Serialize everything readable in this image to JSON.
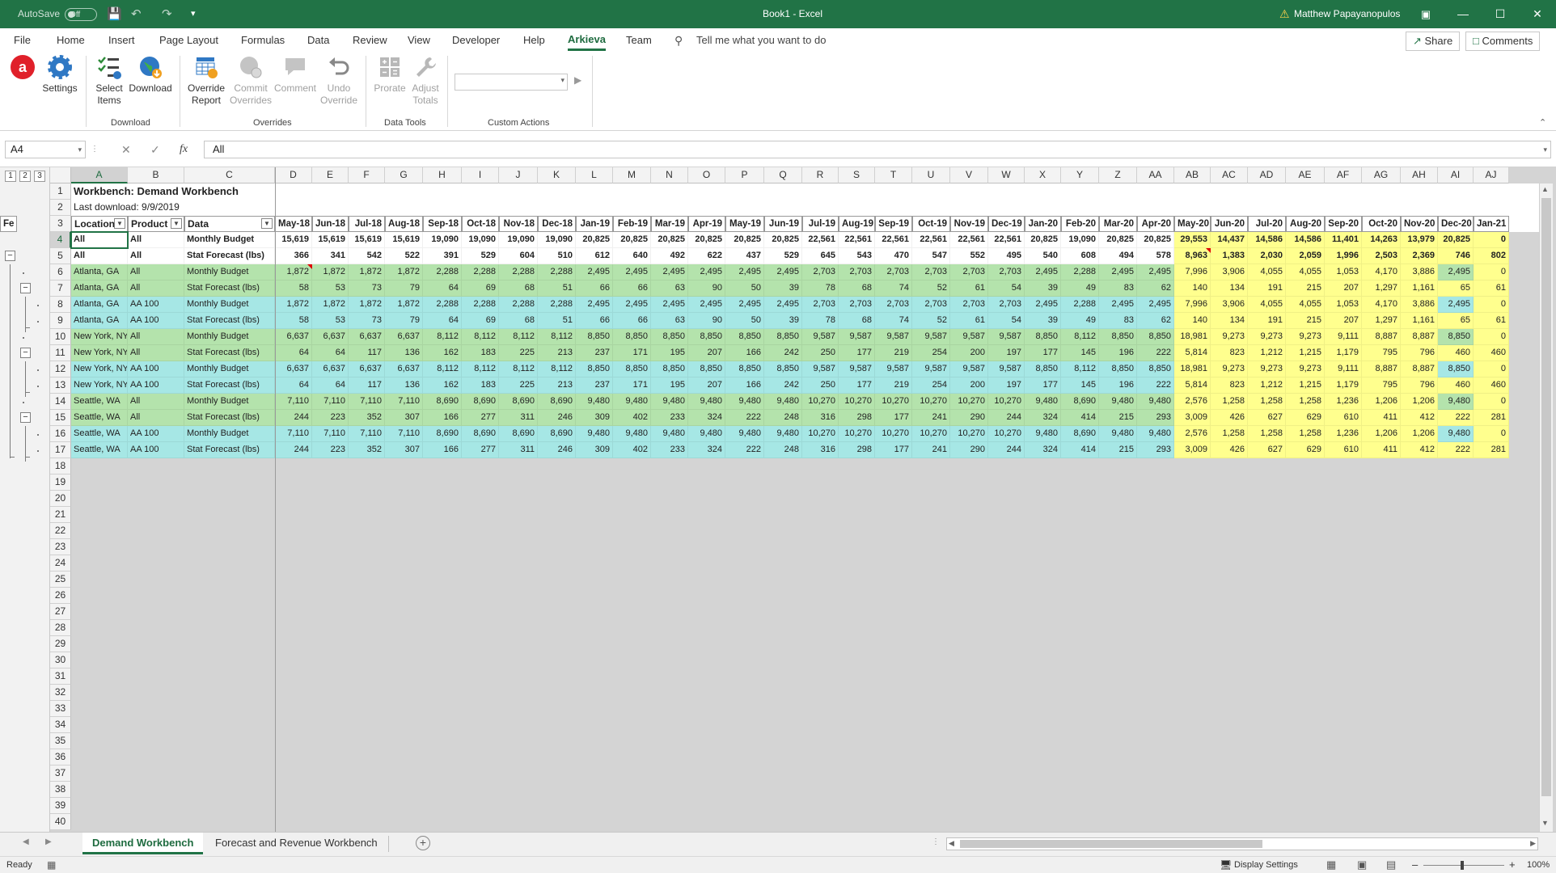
{
  "titlebar": {
    "autosave_label": "AutoSave",
    "autosave_state": "Off",
    "title": "Book1 - Excel",
    "user": "Matthew Papayanopulos"
  },
  "tabs": [
    "File",
    "Home",
    "Insert",
    "Page Layout",
    "Formulas",
    "Data",
    "Review",
    "View",
    "Developer",
    "Help",
    "Arkieva",
    "Team"
  ],
  "active_tab": "Arkieva",
  "tell_me": "Tell me what you want to do",
  "share_label": "Share",
  "comments_label": "Comments",
  "ribbon": {
    "settings": "Settings",
    "select_items": [
      "Select",
      "Items"
    ],
    "download": "Download",
    "override_report": [
      "Override",
      "Report"
    ],
    "commit_overrides": [
      "Commit",
      "Overrides"
    ],
    "comment": "Comment",
    "undo_override": [
      "Undo",
      "Override"
    ],
    "prorate": "Prorate",
    "adjust_totals": [
      "Adjust",
      "Totals"
    ],
    "groups": {
      "download": "Download",
      "overrides": "Overrides",
      "data_tools": "Data Tools",
      "custom_actions": "Custom Actions"
    }
  },
  "formula_bar": {
    "name_box": "A4",
    "value": "All"
  },
  "outline_levels": [
    "1",
    "2",
    "3"
  ],
  "sheet": {
    "title": "Workbench: Demand Workbench",
    "last_download": "Last download: 9/9/2019",
    "selected_cell": "A4",
    "columns": [
      "A",
      "B",
      "C",
      "D",
      "E",
      "F",
      "G",
      "H",
      "I",
      "J",
      "K",
      "L",
      "M",
      "N",
      "O",
      "P",
      "Q",
      "R",
      "S",
      "T",
      "U",
      "V",
      "W",
      "X",
      "Y",
      "Z",
      "AA",
      "AB",
      "AC",
      "AD",
      "AE",
      "AF",
      "AG",
      "AH",
      "AI",
      "AJ"
    ],
    "header_labels": [
      "Location",
      "Product",
      "Data"
    ],
    "months": [
      "May-18",
      "Jun-18",
      "Jul-18",
      "Aug-18",
      "Sep-18",
      "Oct-18",
      "Nov-18",
      "Dec-18",
      "Jan-19",
      "Feb-19",
      "Mar-19",
      "Apr-19",
      "May-19",
      "Jun-19",
      "Jul-19",
      "Aug-19",
      "Sep-19",
      "Oct-19",
      "Nov-19",
      "Dec-19",
      "Jan-20",
      "Feb-20",
      "Mar-20",
      "Apr-20",
      "May-20",
      "Jun-20",
      "Jul-20",
      "Aug-20",
      "Sep-20",
      "Oct-20",
      "Nov-20",
      "Dec-20",
      "Jan-21",
      "Fe"
    ],
    "row_numbers": [
      "1",
      "2",
      "3",
      "4",
      "5",
      "6",
      "7",
      "8",
      "9",
      "10",
      "11",
      "12",
      "13",
      "14",
      "15",
      "16",
      "17",
      "18",
      "19",
      "20",
      "21",
      "22",
      "23",
      "24",
      "25",
      "26",
      "27",
      "28",
      "29",
      "30",
      "31",
      "32",
      "33",
      "34",
      "35",
      "36",
      "37",
      "38",
      "39",
      "40"
    ],
    "rows": [
      {
        "loc": "All",
        "prod": "All",
        "data": "Monthly Budget",
        "values": [
          "15,619",
          "15,619",
          "15,619",
          "15,619",
          "19,090",
          "19,090",
          "19,090",
          "19,090",
          "20,825",
          "20,825",
          "20,825",
          "20,825",
          "20,825",
          "20,825",
          "22,561",
          "22,561",
          "22,561",
          "22,561",
          "22,561",
          "22,561",
          "20,825",
          "19,090",
          "20,825",
          "20,825",
          "29,553",
          "14,437",
          "14,586",
          "14,586",
          "11,401",
          "14,263",
          "13,979",
          "20,825",
          "0"
        ]
      },
      {
        "loc": "All",
        "prod": "All",
        "data": "Stat Forecast (lbs)",
        "values": [
          "366",
          "341",
          "542",
          "522",
          "391",
          "529",
          "604",
          "510",
          "612",
          "640",
          "492",
          "622",
          "437",
          "529",
          "645",
          "543",
          "470",
          "547",
          "552",
          "495",
          "540",
          "608",
          "494",
          "578",
          "8,963",
          "1,383",
          "2,030",
          "2,059",
          "1,996",
          "2,503",
          "2,369",
          "746",
          "802"
        ]
      },
      {
        "loc": "Atlanta, GA",
        "prod": "All",
        "data": "Monthly Budget",
        "values": [
          "1,872",
          "1,872",
          "1,872",
          "1,872",
          "2,288",
          "2,288",
          "2,288",
          "2,288",
          "2,495",
          "2,495",
          "2,495",
          "2,495",
          "2,495",
          "2,495",
          "2,703",
          "2,703",
          "2,703",
          "2,703",
          "2,703",
          "2,703",
          "2,495",
          "2,288",
          "2,495",
          "2,495",
          "7,996",
          "3,906",
          "4,055",
          "4,055",
          "1,053",
          "4,170",
          "3,886",
          "2,495",
          "0"
        ]
      },
      {
        "loc": "Atlanta, GA",
        "prod": "All",
        "data": "Stat Forecast (lbs)",
        "values": [
          "58",
          "53",
          "73",
          "79",
          "64",
          "69",
          "68",
          "51",
          "66",
          "66",
          "63",
          "90",
          "50",
          "39",
          "78",
          "68",
          "74",
          "52",
          "61",
          "54",
          "39",
          "49",
          "83",
          "62",
          "140",
          "134",
          "191",
          "215",
          "207",
          "1,297",
          "1,161",
          "65",
          "61"
        ]
      },
      {
        "loc": "Atlanta, GA",
        "prod": "AA 100",
        "data": "Monthly Budget",
        "values": [
          "1,872",
          "1,872",
          "1,872",
          "1,872",
          "2,288",
          "2,288",
          "2,288",
          "2,288",
          "2,495",
          "2,495",
          "2,495",
          "2,495",
          "2,495",
          "2,495",
          "2,703",
          "2,703",
          "2,703",
          "2,703",
          "2,703",
          "2,703",
          "2,495",
          "2,288",
          "2,495",
          "2,495",
          "7,996",
          "3,906",
          "4,055",
          "4,055",
          "1,053",
          "4,170",
          "3,886",
          "2,495",
          "0"
        ]
      },
      {
        "loc": "Atlanta, GA",
        "prod": "AA 100",
        "data": "Stat Forecast (lbs)",
        "values": [
          "58",
          "53",
          "73",
          "79",
          "64",
          "69",
          "68",
          "51",
          "66",
          "66",
          "63",
          "90",
          "50",
          "39",
          "78",
          "68",
          "74",
          "52",
          "61",
          "54",
          "39",
          "49",
          "83",
          "62",
          "140",
          "134",
          "191",
          "215",
          "207",
          "1,297",
          "1,161",
          "65",
          "61"
        ]
      },
      {
        "loc": "New York, NY",
        "prod": "All",
        "data": "Monthly Budget",
        "values": [
          "6,637",
          "6,637",
          "6,637",
          "6,637",
          "8,112",
          "8,112",
          "8,112",
          "8,112",
          "8,850",
          "8,850",
          "8,850",
          "8,850",
          "8,850",
          "8,850",
          "9,587",
          "9,587",
          "9,587",
          "9,587",
          "9,587",
          "9,587",
          "8,850",
          "8,112",
          "8,850",
          "8,850",
          "18,981",
          "9,273",
          "9,273",
          "9,273",
          "9,111",
          "8,887",
          "8,887",
          "8,850",
          "0"
        ]
      },
      {
        "loc": "New York, NY",
        "prod": "All",
        "data": "Stat Forecast (lbs)",
        "values": [
          "64",
          "64",
          "117",
          "136",
          "162",
          "183",
          "225",
          "213",
          "237",
          "171",
          "195",
          "207",
          "166",
          "242",
          "250",
          "177",
          "219",
          "254",
          "200",
          "197",
          "177",
          "145",
          "196",
          "222",
          "5,814",
          "823",
          "1,212",
          "1,215",
          "1,179",
          "795",
          "796",
          "460",
          "460"
        ]
      },
      {
        "loc": "New York, NY",
        "prod": "AA 100",
        "data": "Monthly Budget",
        "values": [
          "6,637",
          "6,637",
          "6,637",
          "6,637",
          "8,112",
          "8,112",
          "8,112",
          "8,112",
          "8,850",
          "8,850",
          "8,850",
          "8,850",
          "8,850",
          "8,850",
          "9,587",
          "9,587",
          "9,587",
          "9,587",
          "9,587",
          "9,587",
          "8,850",
          "8,112",
          "8,850",
          "8,850",
          "18,981",
          "9,273",
          "9,273",
          "9,273",
          "9,111",
          "8,887",
          "8,887",
          "8,850",
          "0"
        ]
      },
      {
        "loc": "New York, NY",
        "prod": "AA 100",
        "data": "Stat Forecast (lbs)",
        "values": [
          "64",
          "64",
          "117",
          "136",
          "162",
          "183",
          "225",
          "213",
          "237",
          "171",
          "195",
          "207",
          "166",
          "242",
          "250",
          "177",
          "219",
          "254",
          "200",
          "197",
          "177",
          "145",
          "196",
          "222",
          "5,814",
          "823",
          "1,212",
          "1,215",
          "1,179",
          "795",
          "796",
          "460",
          "460"
        ]
      },
      {
        "loc": "Seattle, WA",
        "prod": "All",
        "data": "Monthly Budget",
        "values": [
          "7,110",
          "7,110",
          "7,110",
          "7,110",
          "8,690",
          "8,690",
          "8,690",
          "8,690",
          "9,480",
          "9,480",
          "9,480",
          "9,480",
          "9,480",
          "9,480",
          "10,270",
          "10,270",
          "10,270",
          "10,270",
          "10,270",
          "10,270",
          "9,480",
          "8,690",
          "9,480",
          "9,480",
          "2,576",
          "1,258",
          "1,258",
          "1,258",
          "1,236",
          "1,206",
          "1,206",
          "9,480",
          "0"
        ]
      },
      {
        "loc": "Seattle, WA",
        "prod": "All",
        "data": "Stat Forecast (lbs)",
        "values": [
          "244",
          "223",
          "352",
          "307",
          "166",
          "277",
          "311",
          "246",
          "309",
          "402",
          "233",
          "324",
          "222",
          "248",
          "316",
          "298",
          "177",
          "241",
          "290",
          "244",
          "324",
          "414",
          "215",
          "293",
          "3,009",
          "426",
          "627",
          "629",
          "610",
          "411",
          "412",
          "222",
          "281"
        ]
      },
      {
        "loc": "Seattle, WA",
        "prod": "AA 100",
        "data": "Monthly Budget",
        "values": [
          "7,110",
          "7,110",
          "7,110",
          "7,110",
          "8,690",
          "8,690",
          "8,690",
          "8,690",
          "9,480",
          "9,480",
          "9,480",
          "9,480",
          "9,480",
          "9,480",
          "10,270",
          "10,270",
          "10,270",
          "10,270",
          "10,270",
          "10,270",
          "9,480",
          "8,690",
          "9,480",
          "9,480",
          "2,576",
          "1,258",
          "1,258",
          "1,258",
          "1,236",
          "1,206",
          "1,206",
          "9,480",
          "0"
        ]
      },
      {
        "loc": "Seattle, WA",
        "prod": "AA 100",
        "data": "Stat Forecast (lbs)",
        "values": [
          "244",
          "223",
          "352",
          "307",
          "166",
          "277",
          "311",
          "246",
          "309",
          "402",
          "233",
          "324",
          "222",
          "248",
          "316",
          "298",
          "177",
          "241",
          "290",
          "244",
          "324",
          "414",
          "215",
          "293",
          "3,009",
          "426",
          "627",
          "629",
          "610",
          "411",
          "412",
          "222",
          "281"
        ]
      }
    ]
  },
  "sheet_tabs": [
    "Demand Workbench",
    "Forecast and Revenue Workbench"
  ],
  "active_sheet": "Demand Workbench",
  "status": {
    "ready": "Ready",
    "display_settings": "Display Settings",
    "zoom": "100%"
  },
  "colors": {
    "accent": "#217346",
    "blue": "#a6e7e5",
    "green": "#b4e3ac",
    "yellow": "#ffff8e"
  }
}
